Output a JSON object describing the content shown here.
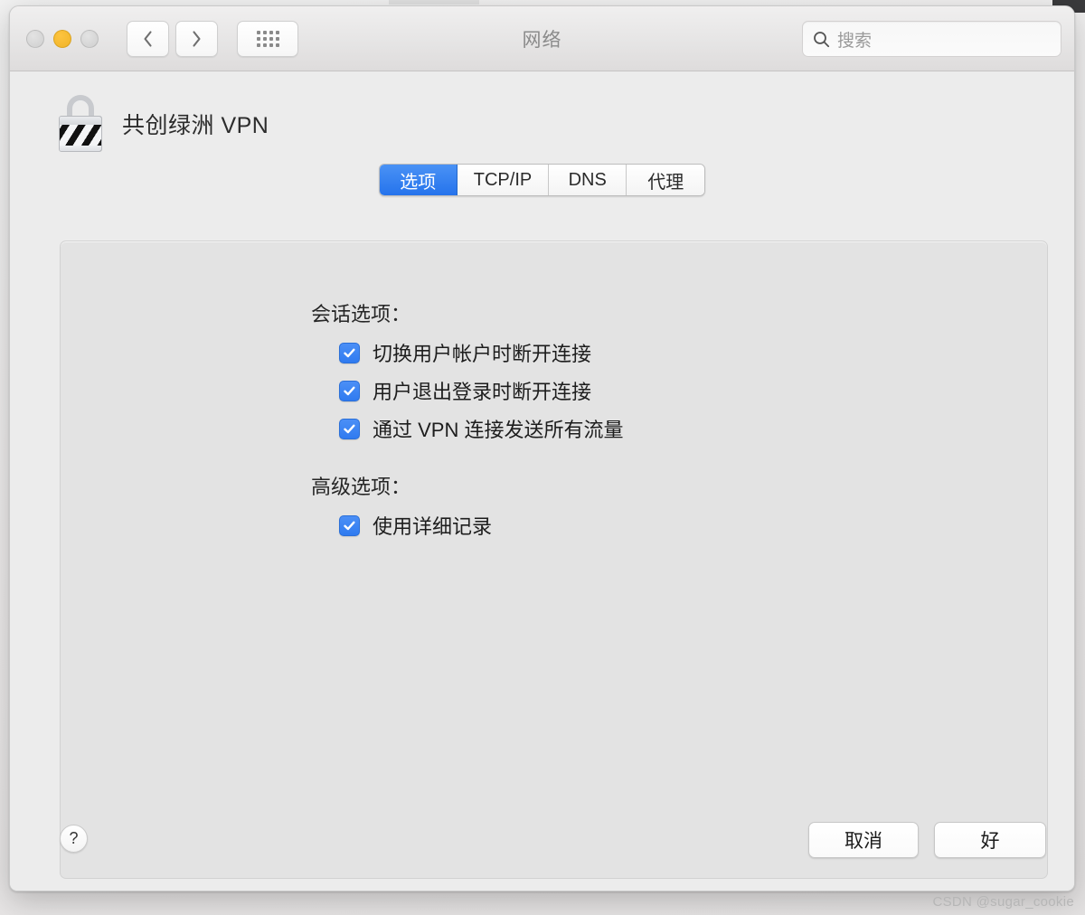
{
  "window": {
    "title": "网络",
    "traffic_lights": [
      {
        "name": "close",
        "color": "#cfcfcf",
        "enabled": false
      },
      {
        "name": "minimize",
        "color": "#f0b429",
        "enabled": true
      },
      {
        "name": "zoom",
        "color": "#cfcfcf",
        "enabled": false
      }
    ],
    "nav": {
      "back": "‹",
      "forward": "›",
      "grid": "grid-view"
    },
    "search": {
      "placeholder": "搜索",
      "value": ""
    }
  },
  "service": {
    "icon": "vpn-lock-icon",
    "name": "共创绿洲 VPN"
  },
  "tabs": [
    {
      "label": "选项",
      "active": true
    },
    {
      "label": "TCP/IP",
      "active": false
    },
    {
      "label": "DNS",
      "active": false
    },
    {
      "label": "代理",
      "active": false
    }
  ],
  "sections": [
    {
      "label": "会话选项：",
      "options": [
        {
          "label": "切换用户帐户时断开连接",
          "checked": true
        },
        {
          "label": "用户退出登录时断开连接",
          "checked": true
        },
        {
          "label": "通过 VPN 连接发送所有流量",
          "checked": true
        }
      ]
    },
    {
      "label": "高级选项：",
      "options": [
        {
          "label": "使用详细记录",
          "checked": true
        }
      ]
    }
  ],
  "footer": {
    "help": "?",
    "cancel_label": "取消",
    "ok_label": "好"
  },
  "watermark": "CSDN @sugar_cookie",
  "colors": {
    "accent": "#2f7bf0",
    "active_tab": "#2573ec",
    "window_bg": "#ececec",
    "panel_bg": "#e3e3e3",
    "title_text": "#8b8b8b"
  }
}
